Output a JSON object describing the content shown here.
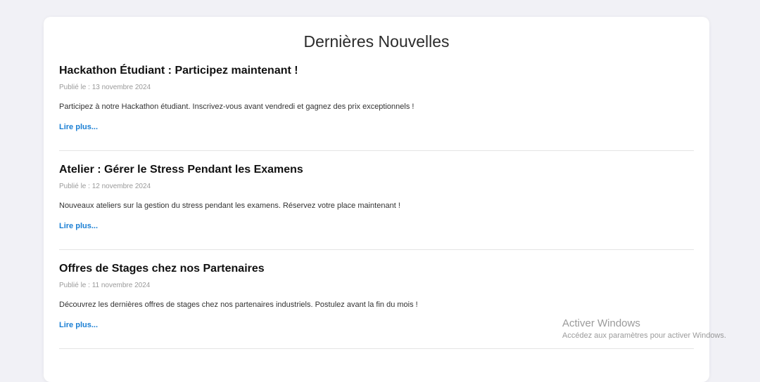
{
  "page": {
    "title": "Dernières Nouvelles"
  },
  "articles": [
    {
      "headline": "Hackathon Étudiant : Participez maintenant !",
      "date": "Publié le : 13 novembre 2024",
      "summary": "Participez à notre Hackathon étudiant. Inscrivez-vous avant vendredi et gagnez des prix exceptionnels !",
      "link": "Lire plus..."
    },
    {
      "headline": "Atelier : Gérer le Stress Pendant les Examens",
      "date": "Publié le : 12 novembre 2024",
      "summary": "Nouveaux ateliers sur la gestion du stress pendant les examens. Réservez votre place maintenant !",
      "link": "Lire plus..."
    },
    {
      "headline": "Offres de Stages chez nos Partenaires",
      "date": "Publié le : 11 novembre 2024",
      "summary": "Découvrez les dernières offres de stages chez nos partenaires industriels. Postulez avant la fin du mois !",
      "link": "Lire plus..."
    }
  ],
  "watermark": {
    "title": "Activer Windows",
    "subtitle": "Accédez aux paramètres pour activer Windows."
  },
  "colors": {
    "background": "#f1f1f6",
    "card": "#ffffff",
    "link": "#1a7fd4",
    "date": "#9a9a9a"
  }
}
